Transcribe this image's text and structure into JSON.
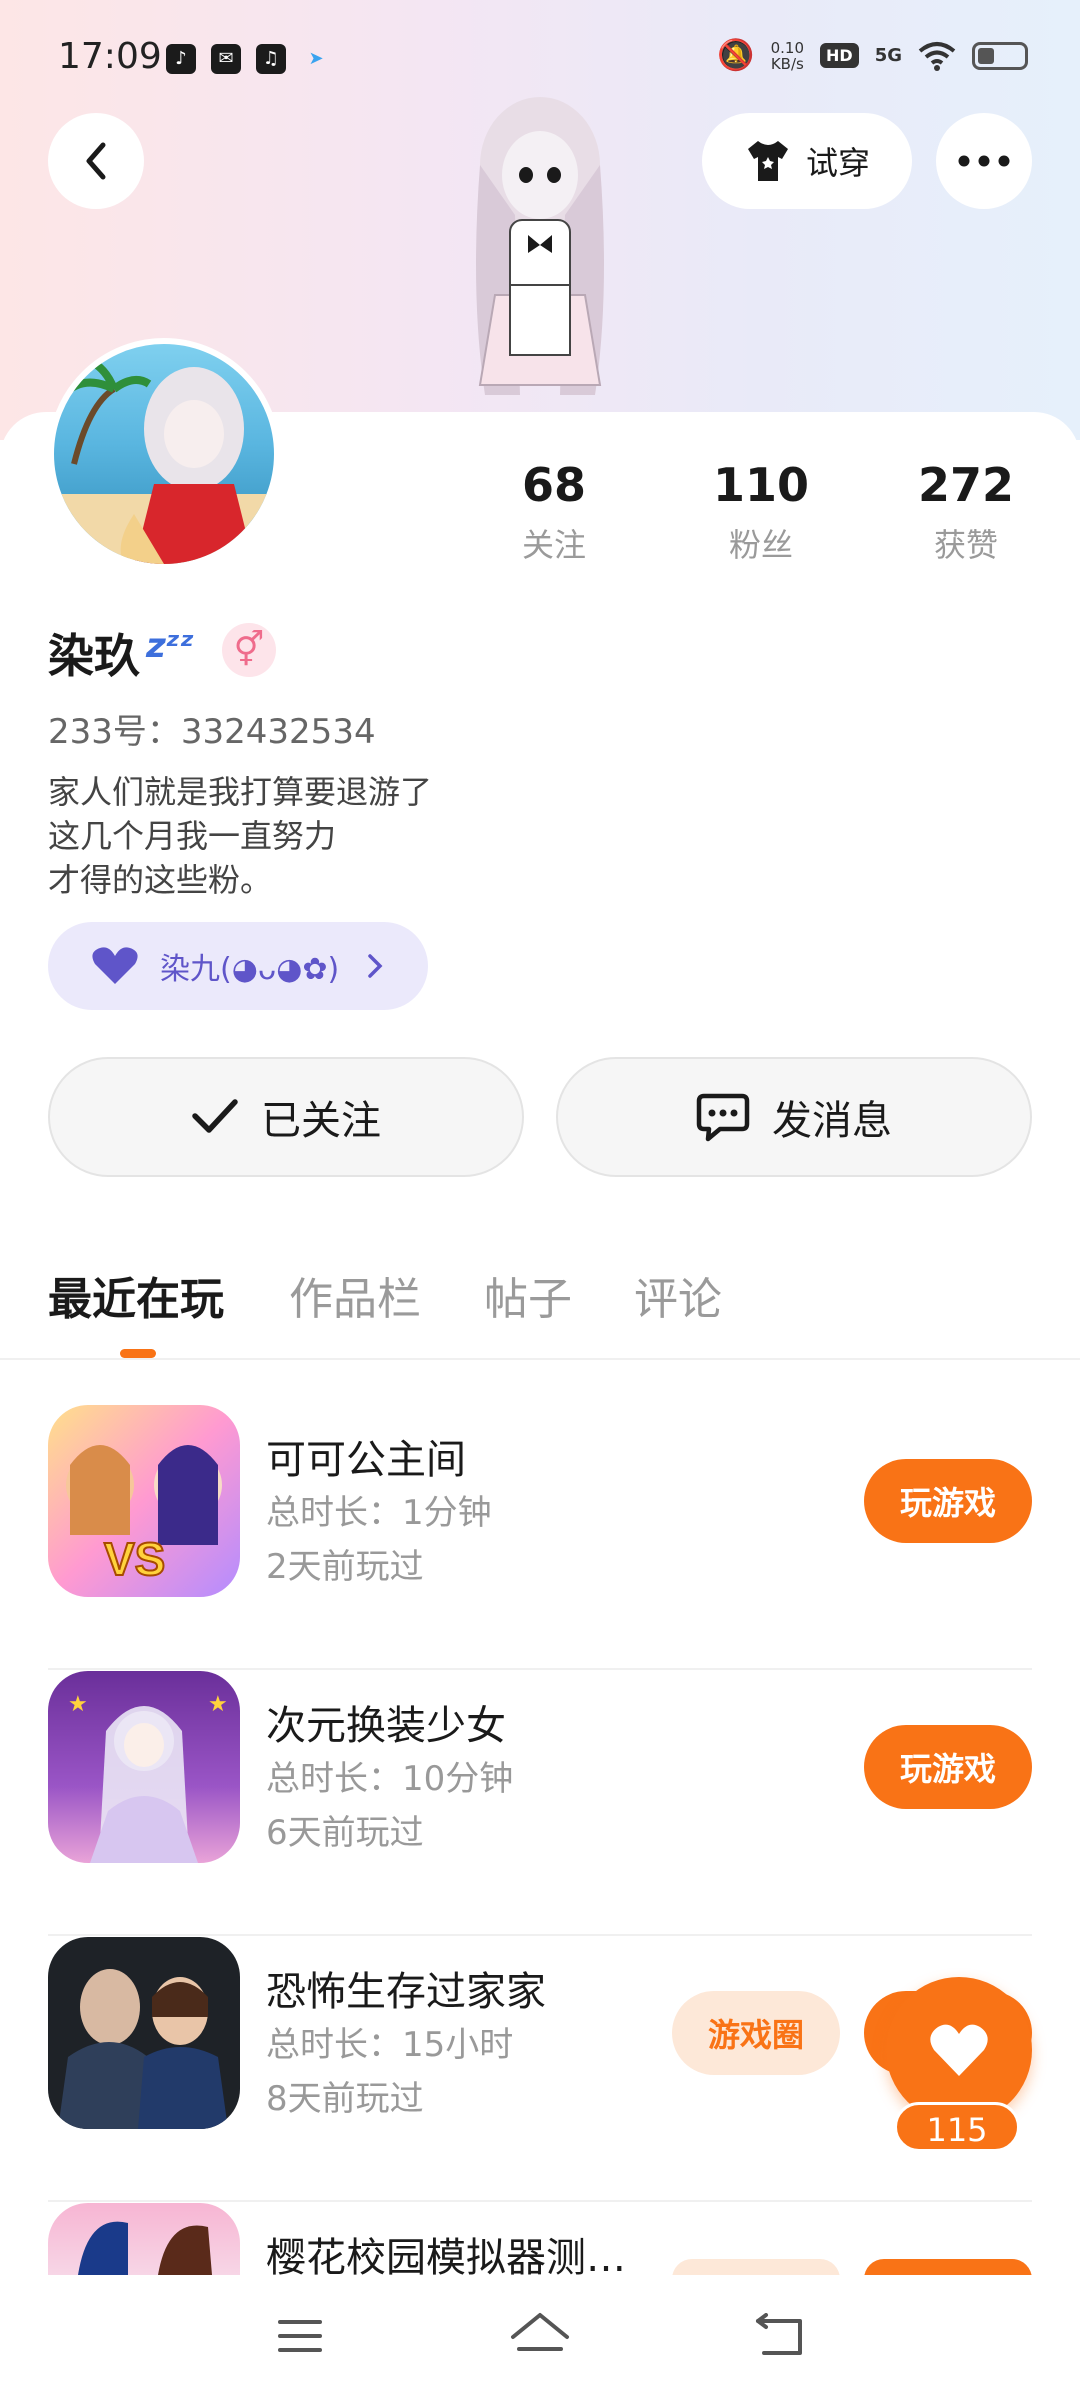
{
  "status_bar": {
    "time": "17:09",
    "net_speed_value": "0.10",
    "net_speed_unit": "KB/s",
    "hd_label": "HD",
    "signal_label": "5G",
    "apps": [
      "douyin-icon",
      "mail-icon",
      "music-icon",
      "share-icon"
    ]
  },
  "header": {
    "tryon_label": "试穿"
  },
  "stats": [
    {
      "value": "68",
      "label": "关注"
    },
    {
      "value": "110",
      "label": "粉丝"
    },
    {
      "value": "272",
      "label": "获赞"
    }
  ],
  "profile": {
    "name": "染玖",
    "status_emoji": "💤",
    "gender_symbol": "⚥",
    "uid": "233号：332432534",
    "bio": "家人们就是我打算要退游了\n这几个月我一直努力\n才得的这些粉。",
    "guild_label": "染九(◕ᴗ◕✿)"
  },
  "actions": {
    "follow_label": "已关注",
    "message_label": "发消息"
  },
  "tabs": [
    "最近在玩",
    "作品栏",
    "帖子",
    "评论"
  ],
  "games": [
    {
      "title": "可可公主间",
      "duration": "总时长：1分钟",
      "last_played": "2天前玩过",
      "play_label": "玩游戏",
      "circle_label": ""
    },
    {
      "title": "次元换装少女",
      "duration": "总时长：10分钟",
      "last_played": "6天前玩过",
      "play_label": "玩游戏",
      "circle_label": ""
    },
    {
      "title": "恐怖生存过家家",
      "duration": "总时长：15小时",
      "last_played": "8天前玩过",
      "play_label": "",
      "circle_label": "游戏圈"
    },
    {
      "title": "樱花校园模拟器测…",
      "duration": "",
      "last_played": "",
      "play_label": "",
      "circle_label": ""
    }
  ],
  "fab": {
    "like_count": "115"
  },
  "colors": {
    "accent": "#f97316",
    "guild": "#5f55c9"
  }
}
